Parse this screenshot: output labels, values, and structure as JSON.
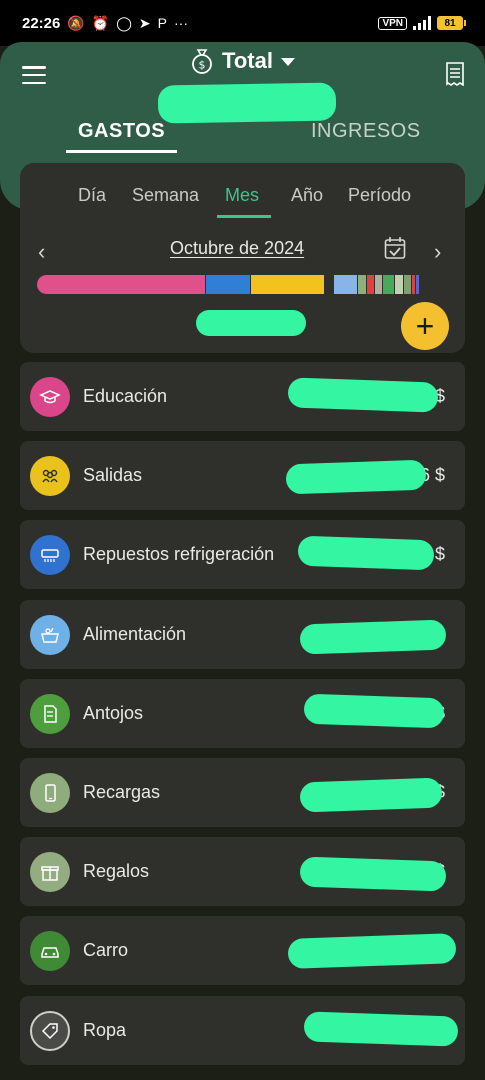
{
  "status_bar": {
    "time": "22:26",
    "vpn": "VPN",
    "battery": "81"
  },
  "header": {
    "title": "Total",
    "tabs": [
      {
        "label": "GASTOS",
        "active": true
      },
      {
        "label": "INGRESOS",
        "active": false
      }
    ],
    "colors": {
      "header_bg": "#2f5d47",
      "accent": "#35c98a",
      "fab": "#f5c02f"
    }
  },
  "period": {
    "tabs": [
      "Día",
      "Semana",
      "Mes",
      "Año",
      "Período"
    ],
    "active": "Mes",
    "label": "Octubre de 2024"
  },
  "category_bar": [
    {
      "color": "#e0508a",
      "share": 0.41
    },
    {
      "color": "#2f7fd6",
      "share": 0.11
    },
    {
      "color": "#f2c21e",
      "share": 0.18
    },
    {
      "color": "#8ab4e8",
      "share": 0.06
    },
    {
      "color": "#8fb07a",
      "share": 0.02
    },
    {
      "color": "#e04040",
      "share": 0.02
    },
    {
      "color": "#b0b0a0",
      "share": 0.02
    },
    {
      "color": "#4aa85a",
      "share": 0.03
    },
    {
      "color": "#c0d0b0",
      "share": 0.02
    },
    {
      "color": "#7fa06f",
      "share": 0.02
    },
    {
      "color": "#d04545",
      "share": 0.01
    },
    {
      "color": "#5566cc",
      "share": 0.01
    }
  ],
  "categories": [
    {
      "label": "Educación",
      "icon": "graduation-cap-icon",
      "color": "#d9478a",
      "amount_suffix": "4 $"
    },
    {
      "label": "Salidas",
      "icon": "people-group-icon",
      "color": "#e9c21c",
      "amount_suffix": "6 $"
    },
    {
      "label": "Repuestos refrigeración",
      "icon": "air-conditioner-icon",
      "color": "#2f72d0",
      "amount_suffix": "$"
    },
    {
      "label": "Alimentación",
      "icon": "basket-icon",
      "color": "#6fb0e6",
      "amount_suffix": ""
    },
    {
      "label": "Antojos",
      "icon": "document-icon",
      "color": "#4f9e3e",
      "amount_suffix": "$"
    },
    {
      "label": "Recargas",
      "icon": "phone-icon",
      "color": "#8fac7d",
      "amount_suffix": "$"
    },
    {
      "label": "Regalos",
      "icon": "gift-icon",
      "color": "#93ad80",
      "amount_suffix": "$"
    },
    {
      "label": "Carro",
      "icon": "car-icon",
      "color": "#418a35",
      "amount_suffix": ""
    },
    {
      "label": "Ropa",
      "icon": "tag-icon",
      "color": "#4a4a46",
      "amount_suffix": ""
    }
  ]
}
